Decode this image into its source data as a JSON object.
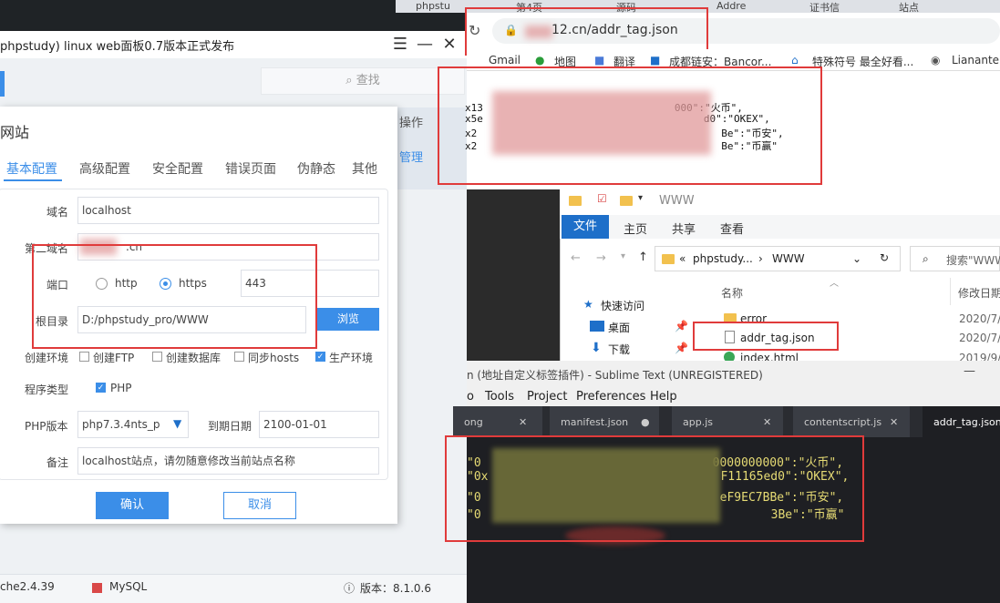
{
  "phpstudy": {
    "window_title": "phpstudy) linux web面板0.7版本正式发布",
    "search_placeholder": "查找",
    "side_operation": "操作",
    "side_manage": "管理",
    "dialog_title": "网站",
    "tabs": [
      "基本配置",
      "高级配置",
      "安全配置",
      "错误页面",
      "伪静态",
      "其他"
    ],
    "domain_label": "域名",
    "domain_value": "localhost",
    "second_domain_label": "第二域名",
    "second_domain_value": ".cn",
    "port_label": "端口",
    "http_label": "http",
    "https_label": "https",
    "port_value": "443",
    "root_label": "根目录",
    "root_value": "D:/phpstudy_pro/WWW",
    "browse_label": "浏览",
    "env_label": "创建环境",
    "env_options": [
      "创建FTP",
      "创建数据库",
      "同步hosts",
      "生产环境"
    ],
    "program_label": "程序类型",
    "program_value": "PHP",
    "php_version_label": "PHP版本",
    "php_version_value": "php7.3.4nts_p",
    "expire_label": "到期日期",
    "expire_value": "2100-01-01",
    "remark_label": "备注",
    "remark_value": "localhost站点，请勿随意修改当前站点名称",
    "ok_label": "确认",
    "cancel_label": "取消",
    "status_apache": "che2.4.39",
    "status_mysql": "MySQL",
    "status_version": "版本：8.1.0.6"
  },
  "browser": {
    "tabs": [
      "phpstu",
      "第4页",
      "源码",
      "Addre",
      "证书信",
      "站点"
    ],
    "url": "12.cn/addr_tag.json",
    "bookmarks": [
      "Gmail",
      "地图",
      "翻译",
      "成都链安：Bancor...",
      "特殊符号 最全好看...",
      "Lianante"
    ],
    "json_lines": [
      {
        "prefix": "x13",
        "suffix": "000\":\"火币\","
      },
      {
        "prefix": "x5e",
        "suffix": "d0\":\"OKEX\","
      },
      {
        "prefix": "x2",
        "suffix": "Be\":\"币安\","
      },
      {
        "prefix": "x2",
        "suffix": "Be\":\"币赢\""
      }
    ]
  },
  "explorer": {
    "title": "WWW",
    "ribbon_file": "文件",
    "ribbon_tabs": [
      "主页",
      "共享",
      "查看"
    ],
    "path": [
      "phpstudy...",
      "WWW"
    ],
    "search_placeholder": "搜索\"WWW",
    "quick_access": "快速访问",
    "desktop": "桌面",
    "downloads": "下载",
    "col_name": "名称",
    "col_modified": "修改日期",
    "files": [
      {
        "name": "error",
        "date": "2020/7/"
      },
      {
        "name": "addr_tag.json",
        "date": "2020/7/"
      },
      {
        "name": "index.html",
        "date": "2019/9/"
      }
    ]
  },
  "sublime": {
    "title": "n (地址自定义标签插件) - Sublime Text (UNREGISTERED)",
    "menu": [
      "o",
      "Tools",
      "Project",
      "Preferences",
      "Help"
    ],
    "tabs": [
      "ong",
      "manifest.json",
      "app.js",
      "contentscript.js",
      "addr_tag.json"
    ],
    "lines": [
      {
        "prefix": "\"0",
        "suffix": "0000000000\":\"火币\","
      },
      {
        "prefix": "\"0x",
        "suffix": "F11165ed0\":\"OKEX\","
      },
      {
        "prefix": "\"0",
        "suffix": "eF9EC7BBe\":\"币安\","
      },
      {
        "prefix": "\"0",
        "suffix": "3Be\":\"币赢\""
      }
    ]
  }
}
